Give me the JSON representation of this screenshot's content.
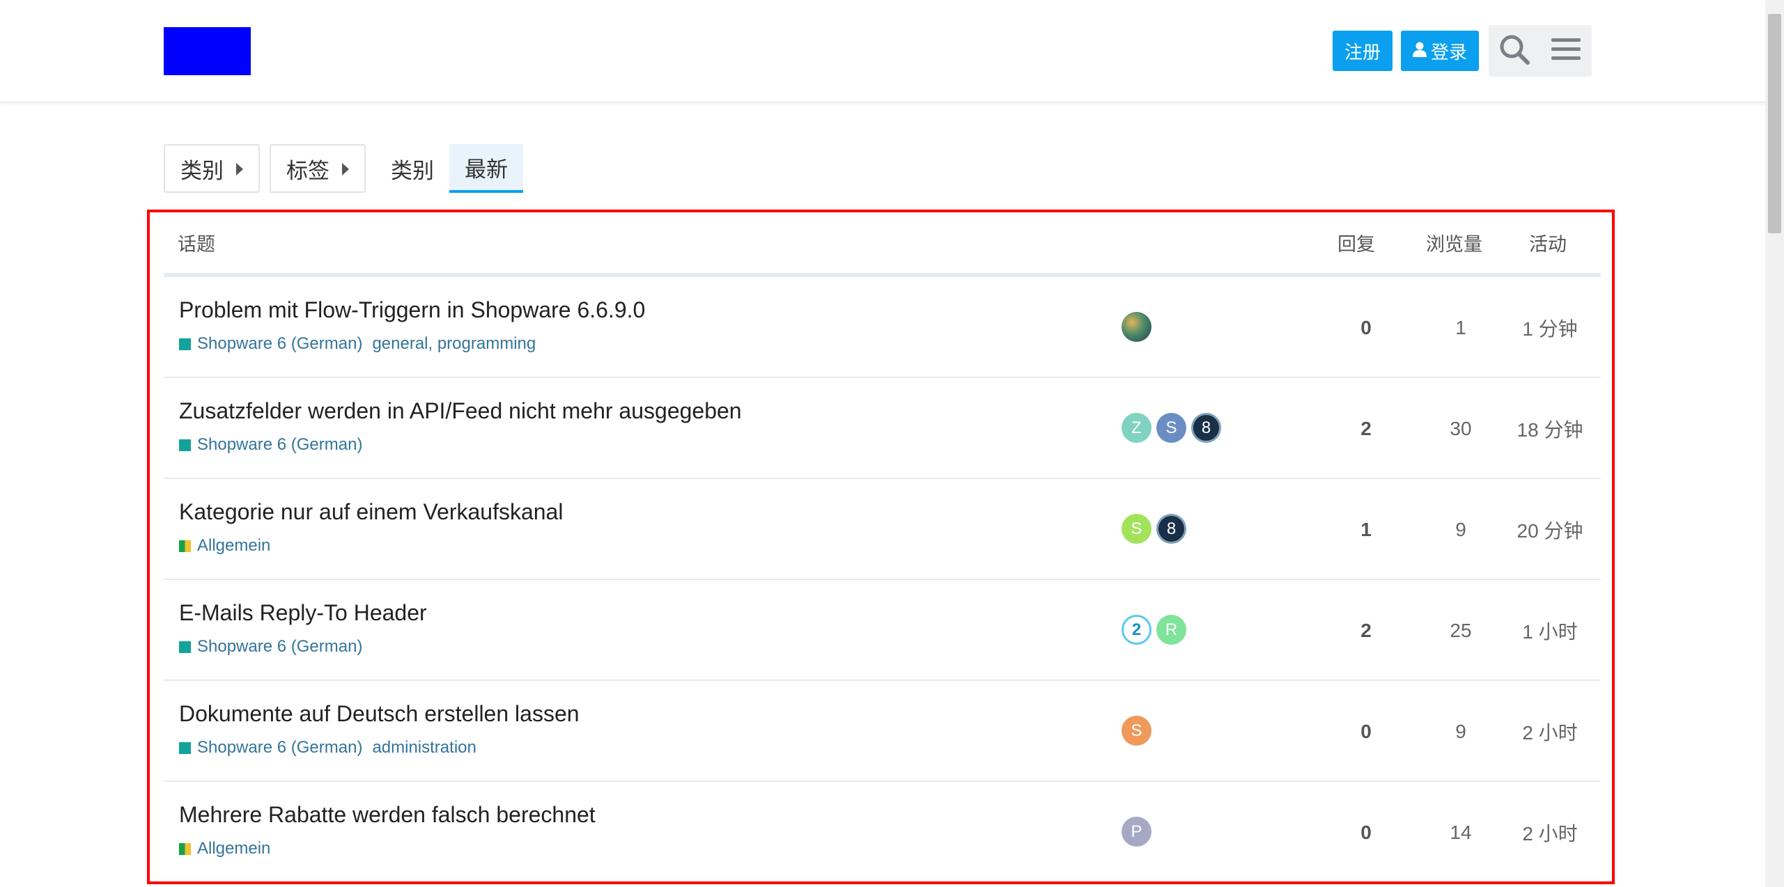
{
  "header": {
    "register": "注册",
    "login": "登录",
    "icons": {
      "user": "user-icon",
      "search": "search-icon",
      "menu": "hamburger-menu-icon"
    },
    "accent": "#0aa0ef"
  },
  "nav": {
    "categories_dropdown": "类别",
    "tags_dropdown": "标签",
    "categories_link": "类别",
    "latest_link": "最新"
  },
  "table": {
    "headers": {
      "topic": "话题",
      "replies": "回复",
      "views": "浏览量",
      "activity": "活动"
    },
    "rows": [
      {
        "title": "Problem mit Flow-Triggern in Shopware 6.6.9.0",
        "category": "Shopware 6 (German)",
        "tags": "general, programming",
        "posters": [
          {
            "label": "",
            "style": "photo"
          }
        ],
        "replies": "0",
        "views": "1",
        "activity": "1 分钟"
      },
      {
        "title": "Zusatzfelder werden in API/Feed nicht mehr ausgegeben",
        "category": "Shopware 6 (German)",
        "tags": "",
        "posters": [
          {
            "label": "Z",
            "color": "#7fd3c0"
          },
          {
            "label": "S",
            "color": "#6a8ec4"
          },
          {
            "label": "8",
            "style": "dark"
          }
        ],
        "replies": "2",
        "views": "30",
        "activity": "18 分钟"
      },
      {
        "title": "Kategorie nur auf einem Verkaufskanal",
        "category": "Allgemein",
        "tags": "",
        "posters": [
          {
            "label": "S",
            "color": "#a3e35c"
          },
          {
            "label": "8",
            "style": "dark"
          }
        ],
        "replies": "1",
        "views": "9",
        "activity": "20 分钟"
      },
      {
        "title": "E-Mails Reply-To Header",
        "category": "Shopware 6 (German)",
        "tags": "",
        "posters": [
          {
            "label": "2",
            "style": "ring"
          },
          {
            "label": "R",
            "color": "#7fe39a"
          }
        ],
        "replies": "2",
        "views": "25",
        "activity": "1 小时"
      },
      {
        "title": "Dokumente auf Deutsch erstellen lassen",
        "category": "Shopware 6 (German)",
        "tags": "administration",
        "posters": [
          {
            "label": "S",
            "color": "#ef9a5a"
          }
        ],
        "replies": "0",
        "views": "9",
        "activity": "2 小时"
      },
      {
        "title": "Mehrere Rabatte werden falsch berechnet",
        "category": "Allgemein",
        "tags": "",
        "posters": [
          {
            "label": "P",
            "color": "#a7a9c4"
          }
        ],
        "replies": "0",
        "views": "14",
        "activity": "2 小时"
      }
    ]
  }
}
